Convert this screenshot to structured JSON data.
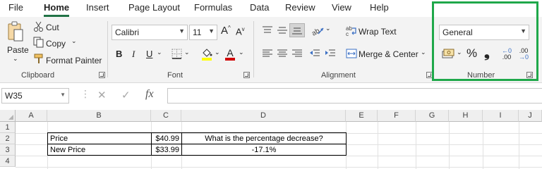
{
  "menu": {
    "tabs": [
      "File",
      "Home",
      "Insert",
      "Page Layout",
      "Formulas",
      "Data",
      "Review",
      "View",
      "Help"
    ],
    "active": "Home"
  },
  "clipboard": {
    "paste_label": "Paste",
    "cut_label": "Cut",
    "copy_label": "Copy",
    "format_painter_label": "Format Painter",
    "group_label": "Clipboard"
  },
  "font": {
    "family": "Calibri",
    "size": "11",
    "bold": "B",
    "italic": "I",
    "underline": "U",
    "grow": "A",
    "shrink": "A",
    "font_color_letter": "A",
    "group_label": "Font",
    "highlight_color": "#ffff00",
    "font_color": "#d00000"
  },
  "alignment": {
    "wrap_text_label": "Wrap Text",
    "merge_center_label": "Merge & Center",
    "group_label": "Alignment"
  },
  "number": {
    "format": "General",
    "percent_symbol": "%",
    "comma_symbol": "❟",
    "increase_decimal_top": "←0",
    "increase_decimal_bottom": ".00",
    "decrease_decimal_top": ".00",
    "decrease_decimal_bottom": "→0",
    "group_label": "Number",
    "highlight_color": "#1fa84a"
  },
  "formula_bar": {
    "name_box": "W35",
    "fx_label": "fx",
    "cancel_symbol": "✕",
    "enter_symbol": "✓",
    "formula": ""
  },
  "sheet": {
    "columns": [
      "A",
      "B",
      "C",
      "D",
      "E",
      "F",
      "G",
      "H",
      "I",
      "J"
    ],
    "rows": [
      "1",
      "2",
      "3",
      "4"
    ],
    "cells": {
      "B2": "Price",
      "C2": "$40.99",
      "D2": "What is the percentage decrease?",
      "B3": "New Price",
      "C3": "$33.99",
      "D3": "-17.1%"
    }
  }
}
